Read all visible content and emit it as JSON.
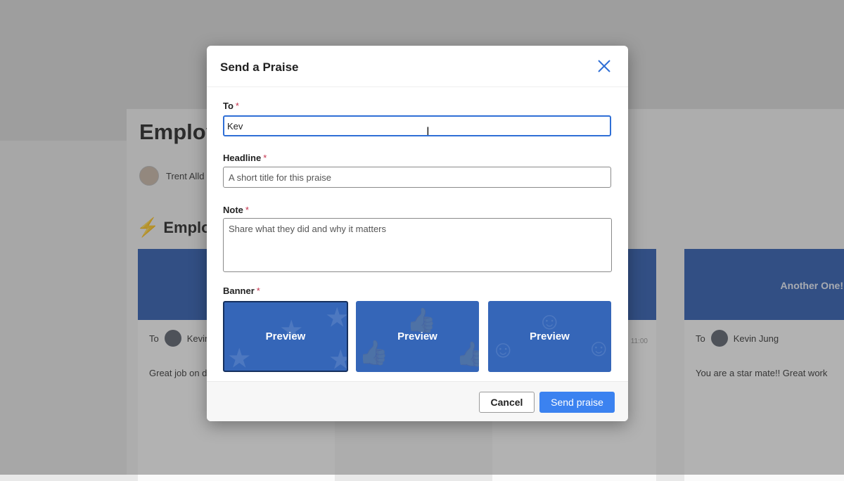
{
  "background": {
    "page_title": "Employ",
    "author": "Trent Alld",
    "section_title": "Employ",
    "cards": [
      {
        "to_label": "To",
        "recipient": "Kevin",
        "message": "Great job on d",
        "banner_text": ""
      },
      {
        "time": "11:00"
      },
      {
        "to_label": "To",
        "recipient": "Kevin Jung",
        "message": "You are a star mate!! Great work",
        "banner_text": "Another One!"
      }
    ]
  },
  "dialog": {
    "title": "Send a Praise",
    "close_icon": "close-icon",
    "fields": {
      "to": {
        "label": "To",
        "required": "*",
        "value": "Kev",
        "placeholder": ""
      },
      "headline": {
        "label": "Headline",
        "required": "*",
        "value": "",
        "placeholder": "A short title for this praise"
      },
      "note": {
        "label": "Note",
        "required": "*",
        "value": "",
        "placeholder": "Share what they did and why it matters"
      },
      "banner": {
        "label": "Banner",
        "required": "*"
      }
    },
    "banners": [
      {
        "label": "Preview",
        "selected": true,
        "pattern": "stars"
      },
      {
        "label": "Preview",
        "selected": false,
        "pattern": "thumbs-up"
      },
      {
        "label": "Preview",
        "selected": false,
        "pattern": "smileys"
      }
    ],
    "buttons": {
      "cancel": "Cancel",
      "send": "Send praise"
    }
  },
  "colors": {
    "accent": "#3b82f0",
    "banner": "#3566b8",
    "focus": "#2f6fd6",
    "required": "#c4314b"
  }
}
